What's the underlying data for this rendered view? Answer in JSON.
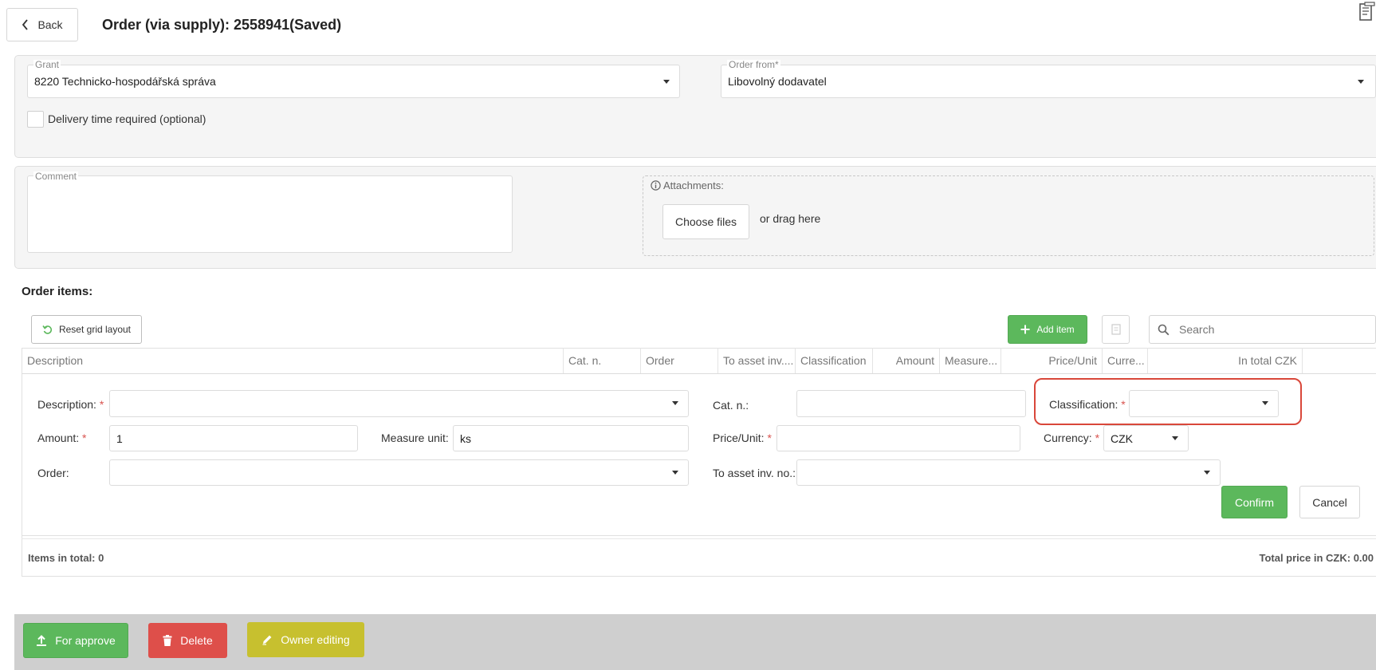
{
  "header": {
    "back_label": "Back",
    "title": "Order (via supply): 2558941(Saved)"
  },
  "grant": {
    "legend": "Grant",
    "value": "8220 Technicko-hospodářská správa"
  },
  "order_from": {
    "legend": "Order from*",
    "value": "Libovolný dodavatel"
  },
  "delivery_time": {
    "label": "Delivery time required (optional)",
    "checked": false
  },
  "comment": {
    "legend": "Comment",
    "value": ""
  },
  "attachments": {
    "legend": "Attachments:",
    "choose_label": "Choose files",
    "drag_label": "or drag here"
  },
  "order_items": {
    "heading": "Order items:",
    "reset_label": "Reset grid layout",
    "add_item_label": "Add item",
    "search_placeholder": "Search",
    "columns": [
      "Description",
      "Cat. n.",
      "Order",
      "To asset inv....",
      "Classification",
      "Amount",
      "Measure...",
      "Price/Unit",
      "Curre...",
      "In total CZK"
    ]
  },
  "edit_form": {
    "description_label": "Description:",
    "description_value": "",
    "cat_label": "Cat. n.:",
    "cat_value": "",
    "classification_label": "Classification:",
    "classification_value": "",
    "amount_label": "Amount:",
    "amount_value": "1",
    "measure_label": "Measure unit:",
    "measure_value": "ks",
    "price_label": "Price/Unit:",
    "price_value": "",
    "currency_label": "Currency:",
    "currency_value": "CZK",
    "order_label": "Order:",
    "order_value": "",
    "asset_label": "To asset inv. no.:",
    "asset_value": "",
    "confirm_label": "Confirm",
    "cancel_label": "Cancel",
    "required_mark": "*"
  },
  "footer": {
    "items_total": "Items in total: 0",
    "total_price": "Total price in CZK: 0.00"
  },
  "actions": {
    "approve_label": "For approve",
    "delete_label": "Delete",
    "owner_label": "Owner editing"
  },
  "colors": {
    "green": "#5cb85c",
    "red": "#de4f4a",
    "olive": "#c7c02f",
    "highlight": "#d9473a"
  }
}
